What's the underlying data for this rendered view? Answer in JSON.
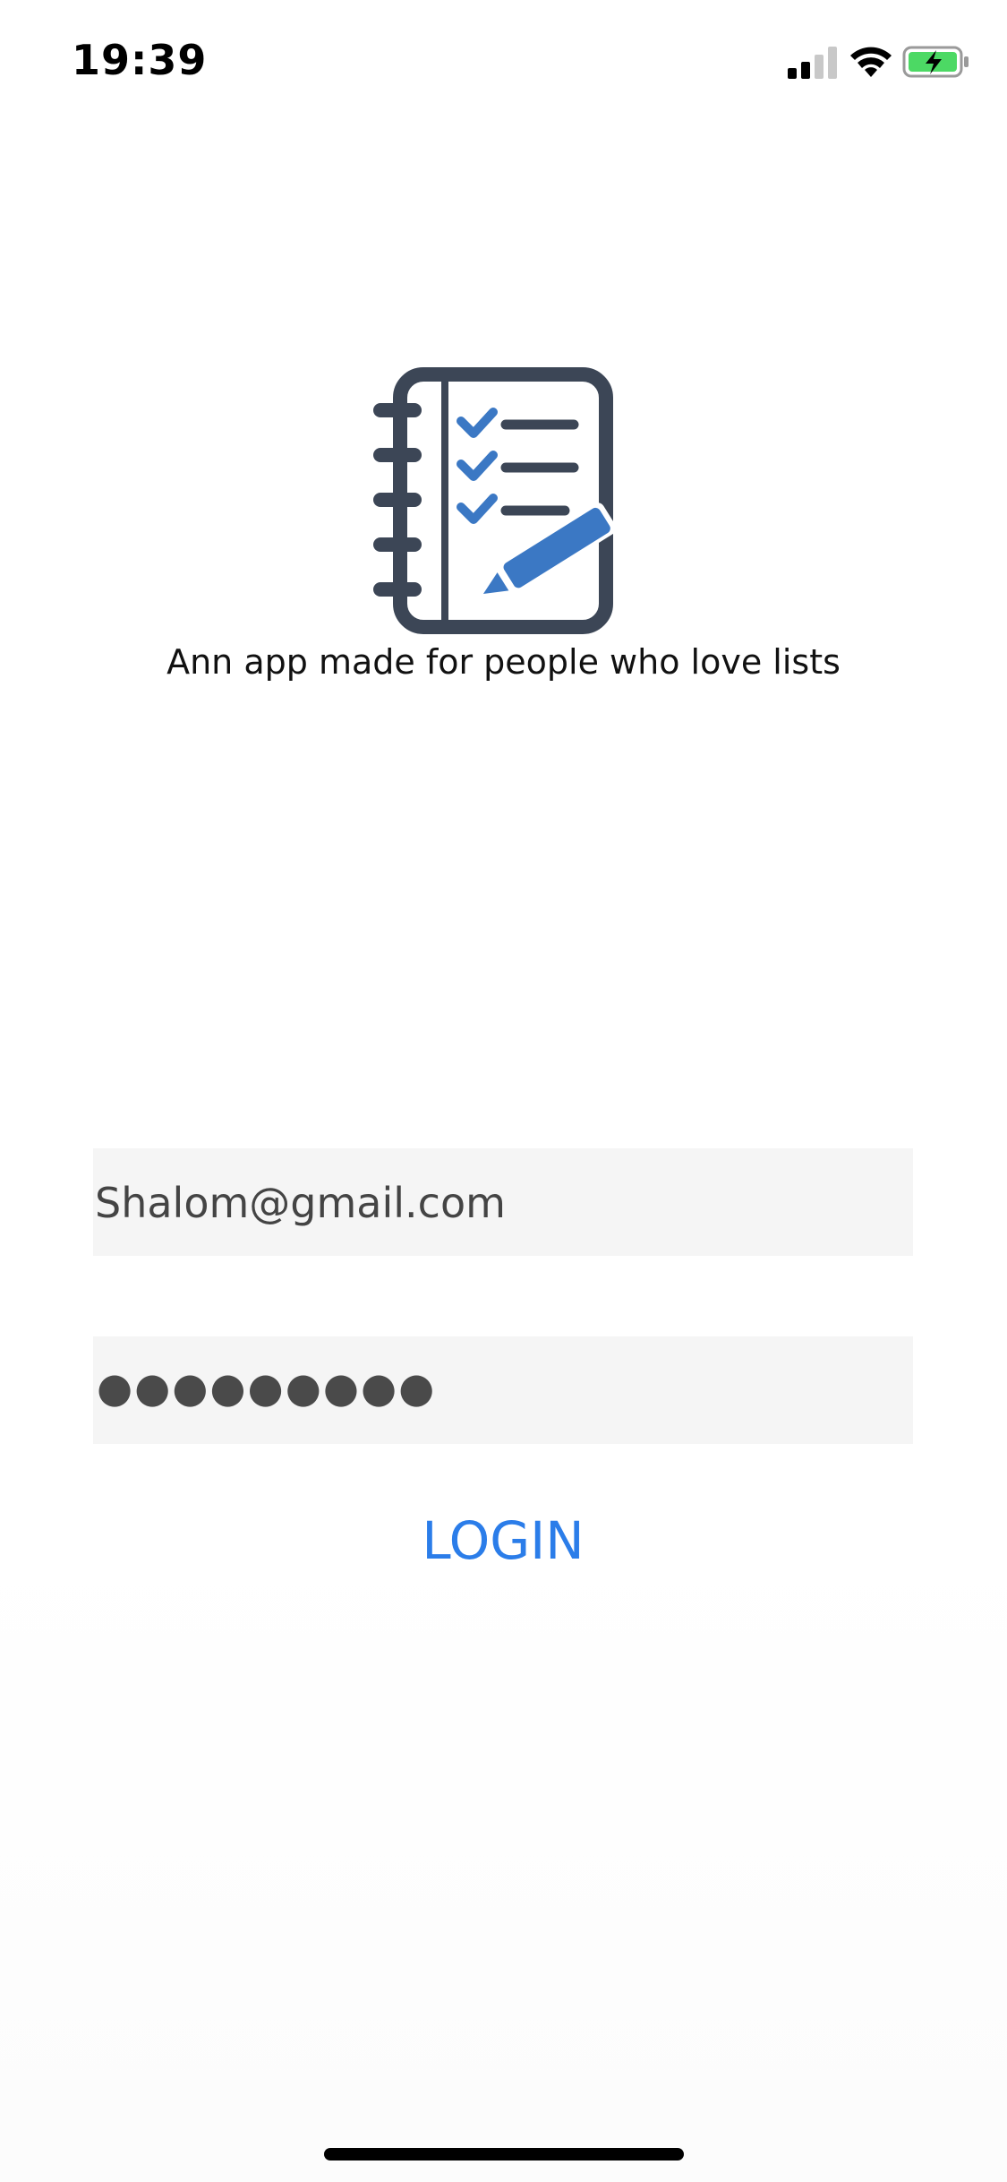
{
  "status_bar": {
    "time": "19:39",
    "signal_icon": "cellular-signal-icon",
    "wifi_icon": "wifi-icon",
    "battery_icon": "battery-charging-icon",
    "battery_color": "#4cd964"
  },
  "branding": {
    "logo_icon": "notebook-checklist-pencil-icon",
    "tagline": "Ann app made for people who love lists",
    "logo_dark_color": "#3c4656",
    "logo_accent_color": "#3b78c4"
  },
  "login_form": {
    "email_value": "Shalom@gmail.com",
    "password_masked": "●●●●●●●●●",
    "login_label": "LOGIN",
    "field_background": "#f5f5f5",
    "accent_color": "#2b7de9"
  }
}
